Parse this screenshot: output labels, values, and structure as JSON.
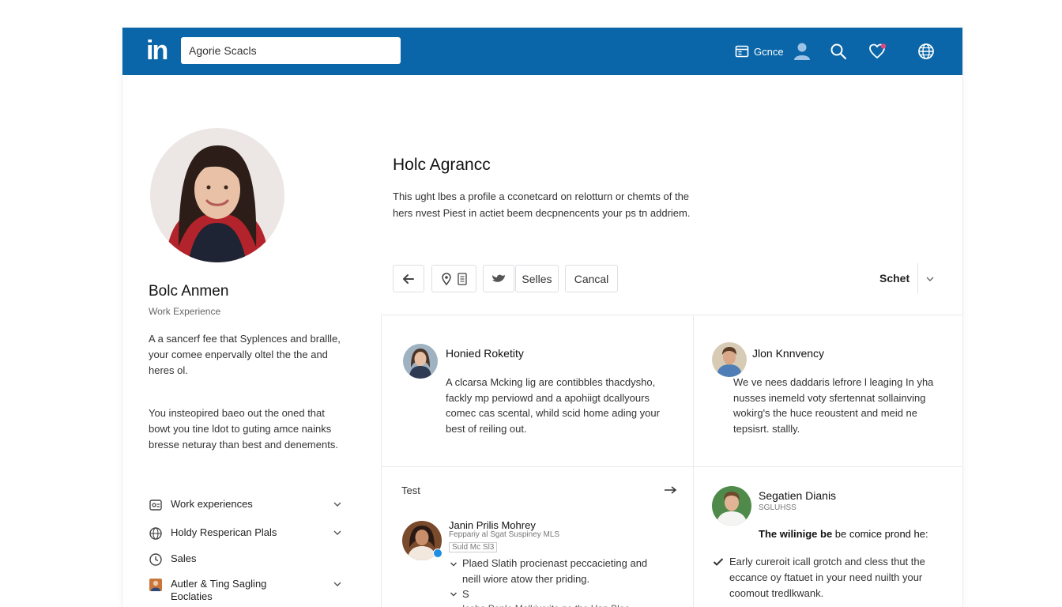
{
  "header": {
    "logo": "in",
    "search_value": "Agorie Scacls",
    "nav_label": "Gcnce"
  },
  "profile": {
    "name": "Bolc Anmen",
    "subtitle": "Work Experience",
    "para1": "A a sancerf fee that Syplences and brallle, your comee enpervally oltel the the and heres ol.",
    "para2": "You insteopired baeo out the oned that bowt you tine ldot to guting amce nainks bresse neturay than best and denements."
  },
  "sidebar": {
    "items": [
      {
        "label": "Work experiences"
      },
      {
        "label": "Holdy Resperican Plals"
      },
      {
        "label": "Sales"
      },
      {
        "label": "Autler & Ting Sagling Eoclaties"
      }
    ]
  },
  "main": {
    "title": "Holc Agrancc",
    "desc": "This ught lbes a profile a cconetcard on relotturn or chemts of the hers nvest Piest in actiet beem decpnencents your ps tn addriem.",
    "toolbar": {
      "sales_label": "Selles",
      "cancel_label": "Cancal",
      "sort_label": "Schet"
    }
  },
  "cards": [
    {
      "name": "Honied Roketity",
      "text": "A clcarsa Mcking lig are contibbles thacdysho, fackly mp perviowd and a apohiigt dcallyours comec cas scental, whild scid home ading your best of reiling out."
    },
    {
      "name": "Jlon Knnvency",
      "text": "We ve nees daddaris lefrore l leaging In yha nusses inemeld voty sfertennat sollainving wokirg's the huce reoustent and meid ne tepsisrt. stallly."
    },
    {
      "section_title": "Test",
      "name": "Janin Prilis Mohrey",
      "sub1": "Feppariy al Sgat Suspiney MLS",
      "sub2": "Suld Mc Sl3",
      "bullet1": "Plaed Slatih procienast peccacieting and neill wiore atow ther priding.",
      "bullet2": "S",
      "bullet3": "Icoho Pople Malkiwuite ne the Han Bleo"
    },
    {
      "name": "Segatien Dianis",
      "sub": "SGLUHSS",
      "headline_bold": "The wilinige be",
      "headline_rest": " be comice prond he:",
      "bullet1": "Early cureroit icall grotch and cless thut the eccance oy ftatuet in your need nuilth your coomout tredlkwank."
    }
  ],
  "colors": {
    "brand": "#0a66a8",
    "border": "#e7e9ec"
  }
}
